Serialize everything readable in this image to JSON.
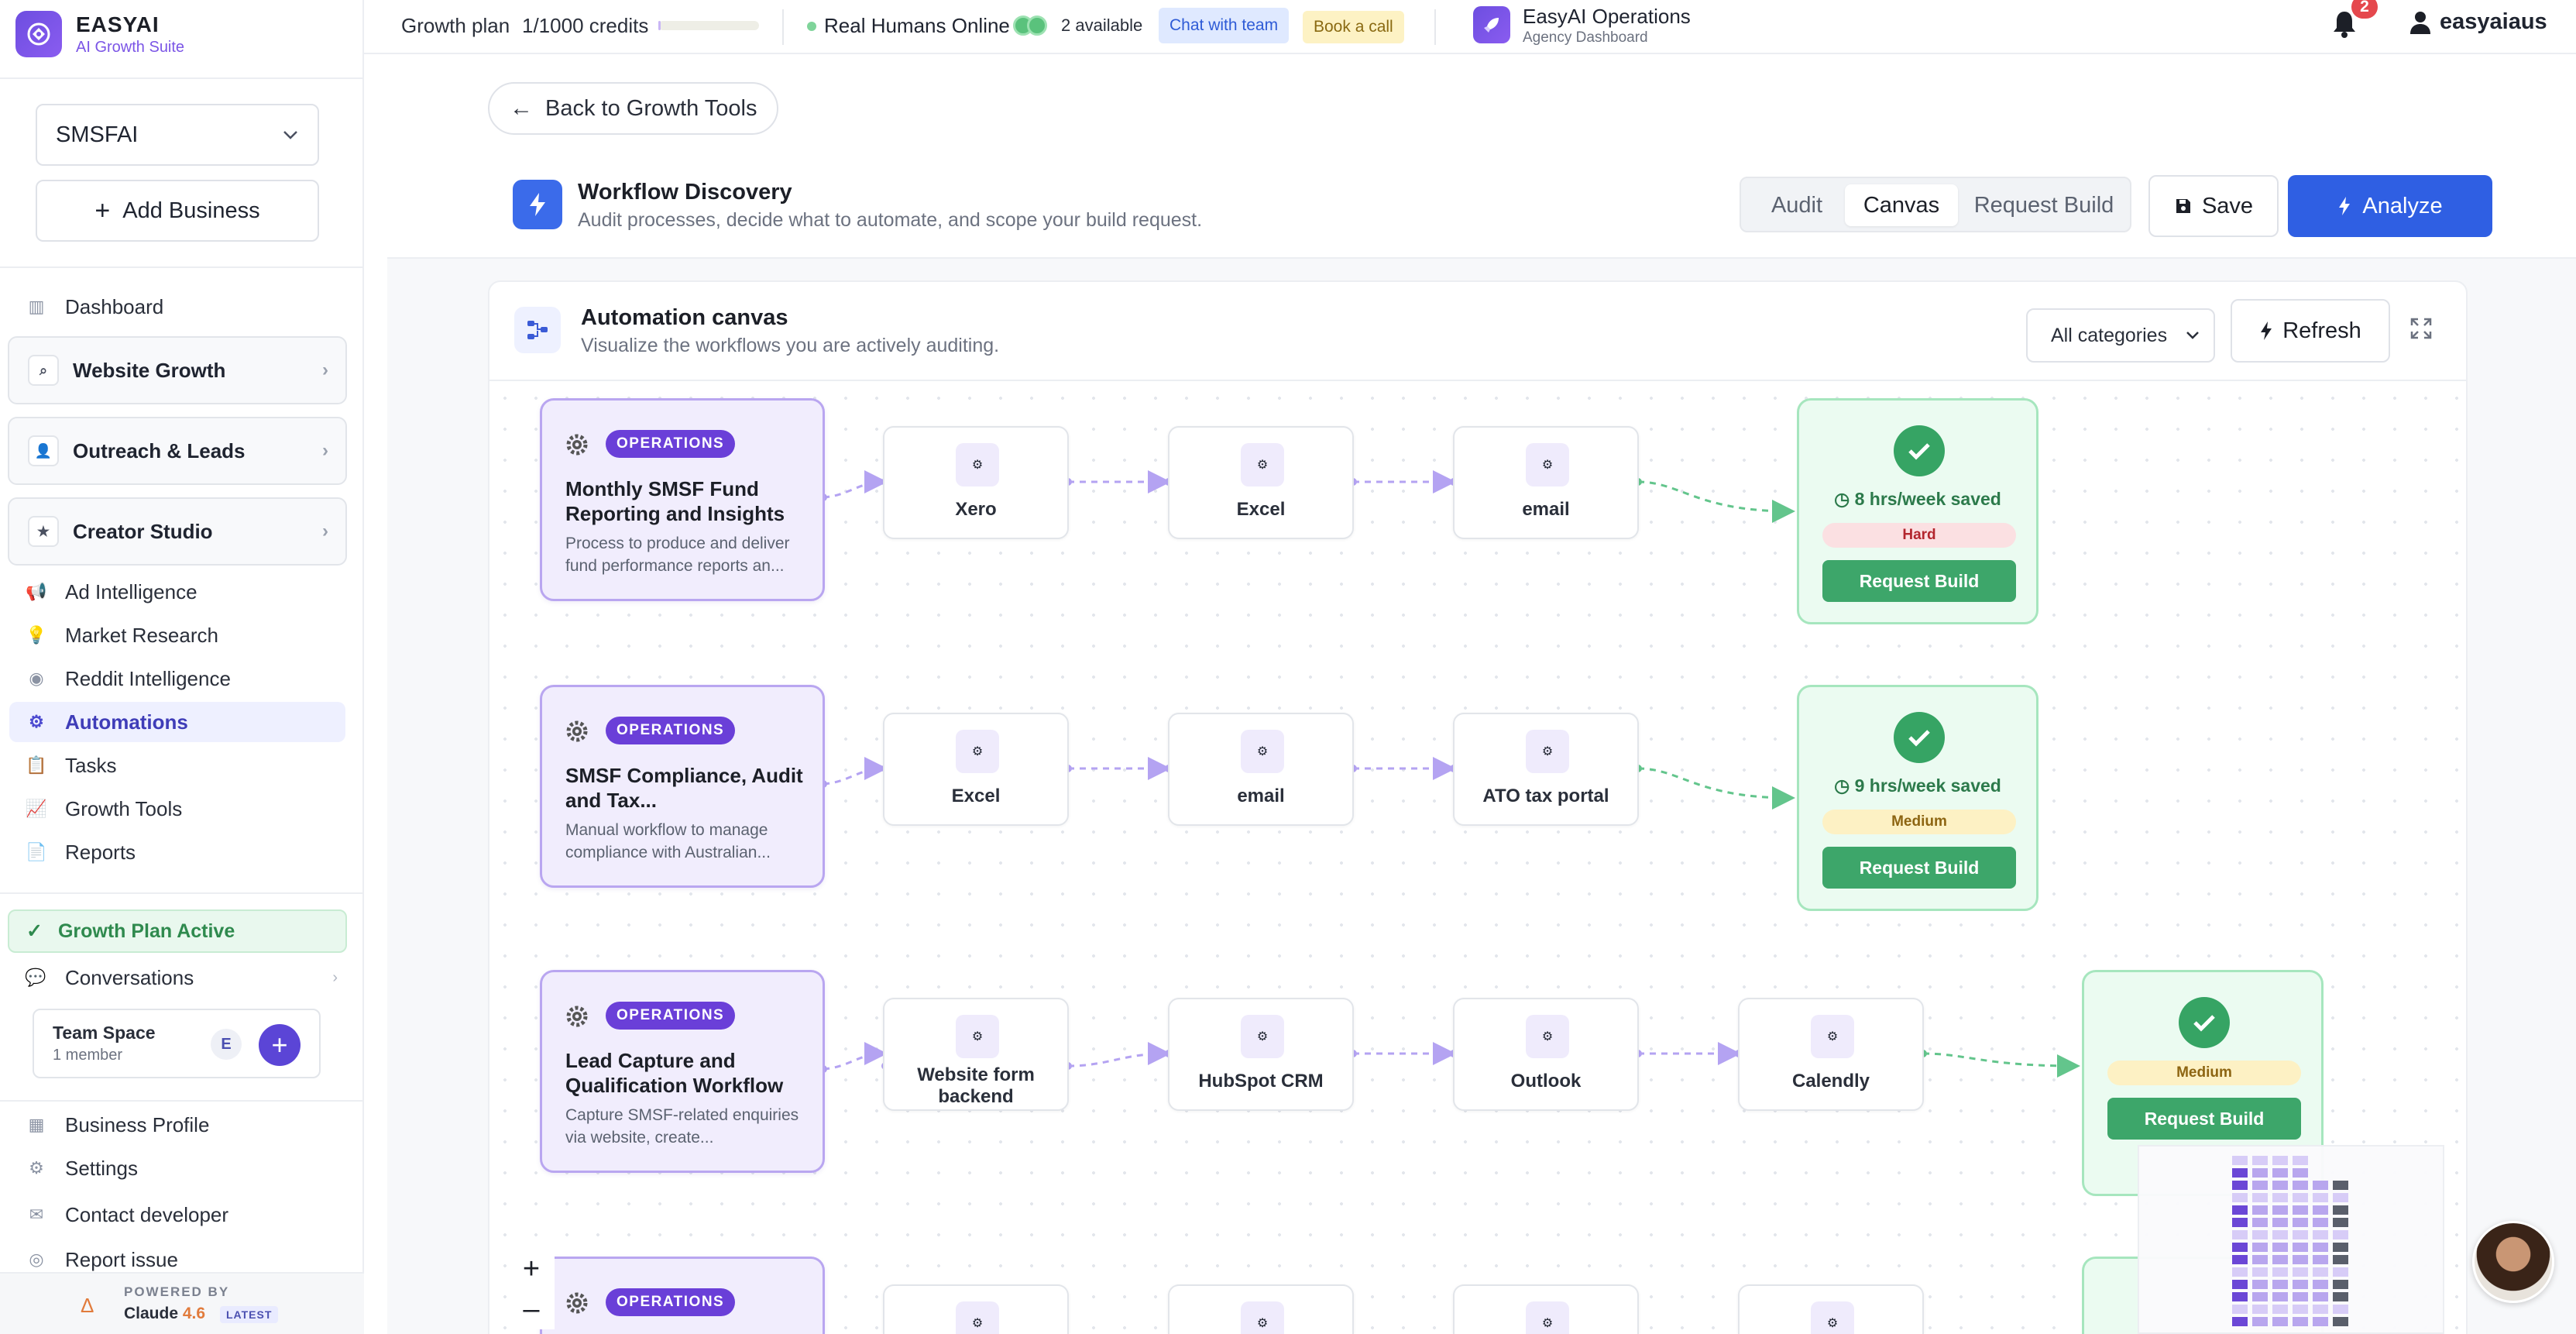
{
  "brand": {
    "name": "EASYAI",
    "subtitle": "AI Growth Suite"
  },
  "sidebar": {
    "business_select": "SMSFAI",
    "add_business": "Add Business",
    "dashboard": "Dashboard",
    "groups": [
      "Website Growth",
      "Outreach & Leads",
      "Creator Studio"
    ],
    "items": [
      "Ad Intelligence",
      "Market Research",
      "Reddit Intelligence",
      "Automations",
      "Tasks",
      "Growth Tools",
      "Reports"
    ],
    "active_item": "Automations",
    "plan_status": "Growth Plan Active",
    "conversations": "Conversations",
    "team": {
      "name": "Team Space",
      "members": "1 member",
      "avatar_initial": "E"
    },
    "footer_items": [
      "Business Profile",
      "Settings",
      "Contact developer",
      "Report issue"
    ],
    "powered_by": "POWERED BY",
    "model_name": "Claude",
    "model_version": "4.6",
    "model_badge": "LATEST"
  },
  "topbar": {
    "plan": "Growth plan",
    "credits": "1/1000 credits",
    "credits_used_fraction": 0.001,
    "humans": "Real Humans Online",
    "available": "2 available",
    "chat_button": "Chat with team",
    "call_button": "Book a call",
    "workspace_title": "EasyAI Operations",
    "workspace_subtitle": "Agency Dashboard",
    "notification_count": "2",
    "username": "easyaiaus"
  },
  "main": {
    "back_button": "Back to Growth Tools",
    "title": "Workflow Discovery",
    "subtitle": "Audit processes, decide what to automate, and scope your build request.",
    "tabs": [
      "Audit",
      "Canvas",
      "Request Build"
    ],
    "active_tab": "Canvas",
    "save_button": "Save",
    "analyze_button": "Analyze"
  },
  "canvas": {
    "title": "Automation canvas",
    "subtitle": "Visualize the workflows you are actively auditing.",
    "category_filter": "All categories",
    "refresh_button": "Refresh",
    "workflows": [
      {
        "tag": "OPERATIONS",
        "name": "Monthly SMSF Fund Reporting and Insights",
        "description": "Process to produce and deliver fund performance reports an...",
        "tools": [
          "Xero",
          "Excel",
          "email"
        ],
        "saved": "8 hrs/week saved",
        "difficulty": "Hard",
        "action": "Request Build"
      },
      {
        "tag": "OPERATIONS",
        "name": "SMSF Compliance, Audit and Tax...",
        "description": "Manual workflow to manage compliance with Australian...",
        "tools": [
          "Excel",
          "email",
          "ATO tax portal"
        ],
        "saved": "9 hrs/week saved",
        "difficulty": "Medium",
        "action": "Request Build"
      },
      {
        "tag": "OPERATIONS",
        "name": "Lead Capture and Qualification Workflow",
        "description": "Capture SMSF-related enquiries via website, create...",
        "tools": [
          "Website form backend",
          "HubSpot CRM",
          "Outlook",
          "Calendly"
        ],
        "saved": "",
        "difficulty": "Medium",
        "action": "Request Build"
      },
      {
        "tag": "OPERATIONS",
        "name": "",
        "description": "",
        "tools": [
          "",
          "",
          "",
          ""
        ],
        "saved": "",
        "difficulty": "",
        "action": ""
      }
    ],
    "zoom_in": "+",
    "zoom_out": "–"
  },
  "colors": {
    "accent": "#2f5fe3",
    "brand": "#6a3fd8",
    "success": "#3da66a",
    "hard": "#b3262e",
    "medium": "#8d6512"
  }
}
